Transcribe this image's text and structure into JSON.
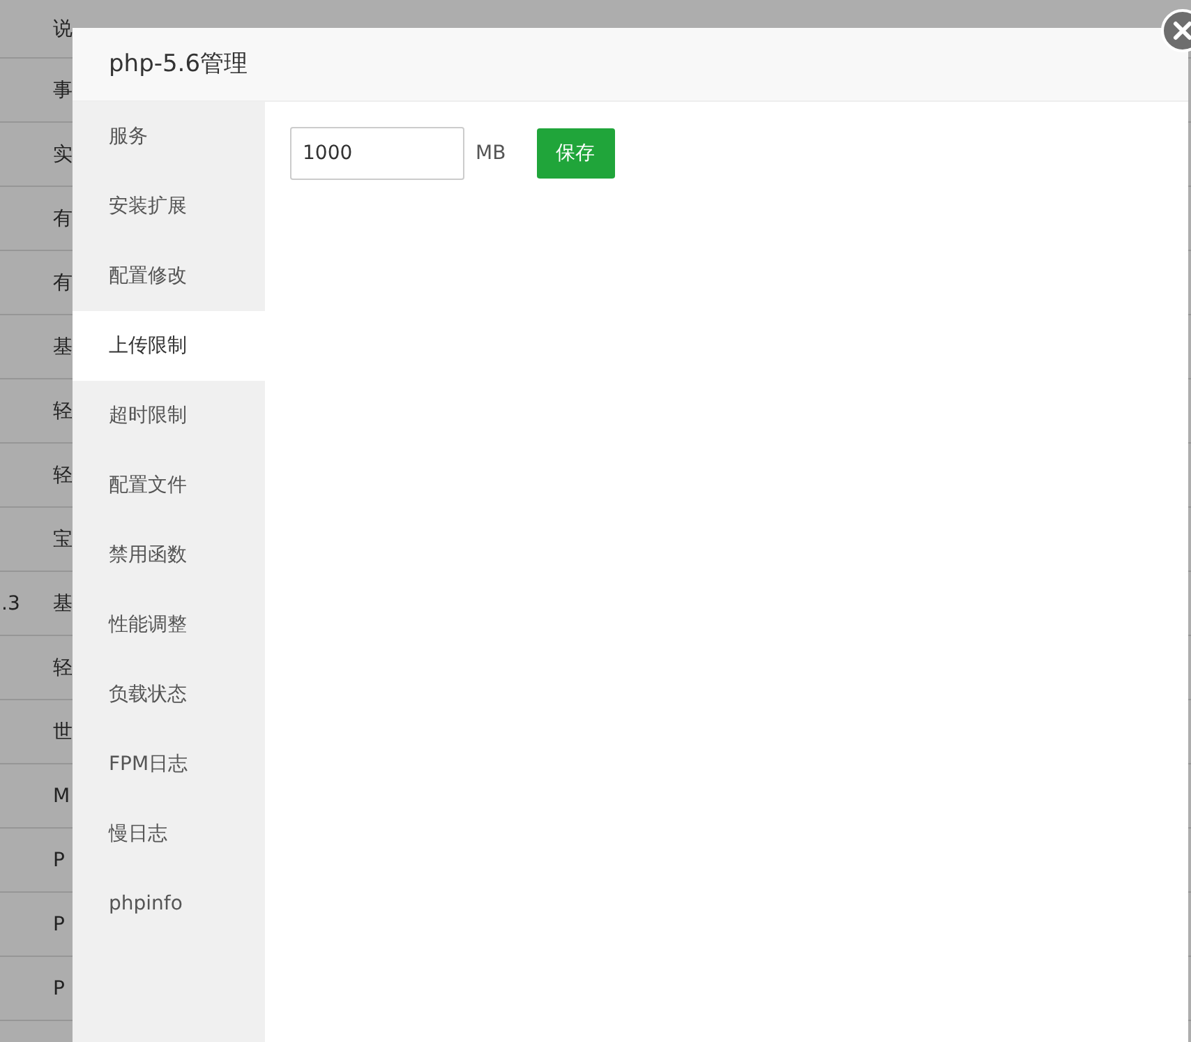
{
  "background_table": {
    "header": {
      "column_2": "说"
    },
    "rows": [
      {
        "column_2": "事"
      },
      {
        "column_2": "实"
      },
      {
        "column_2": "有"
      },
      {
        "column_2": "有"
      },
      {
        "column_2": "基"
      },
      {
        "column_2": "轻"
      },
      {
        "column_2": "轻"
      },
      {
        "column_2": "宝"
      },
      {
        "column_1": ".3",
        "column_2": "基"
      },
      {
        "column_2": "轻"
      },
      {
        "column_2": "世"
      },
      {
        "column_2": "M"
      },
      {
        "column_2": "P"
      },
      {
        "column_2": "P"
      },
      {
        "column_2": "P"
      }
    ]
  },
  "dialog": {
    "title": "php-5.6管理",
    "tabs": [
      {
        "label": "服务",
        "selected": false
      },
      {
        "label": "安装扩展",
        "selected": false
      },
      {
        "label": "配置修改",
        "selected": false
      },
      {
        "label": "上传限制",
        "selected": true
      },
      {
        "label": "超时限制",
        "selected": false
      },
      {
        "label": "配置文件",
        "selected": false
      },
      {
        "label": "禁用函数",
        "selected": false
      },
      {
        "label": "性能调整",
        "selected": false
      },
      {
        "label": "负载状态",
        "selected": false
      },
      {
        "label": "FPM日志",
        "selected": false
      },
      {
        "label": "慢日志",
        "selected": false
      },
      {
        "label": "phpinfo",
        "selected": false
      }
    ],
    "form": {
      "value": "1000",
      "unit": "MB",
      "button": "保存"
    }
  }
}
